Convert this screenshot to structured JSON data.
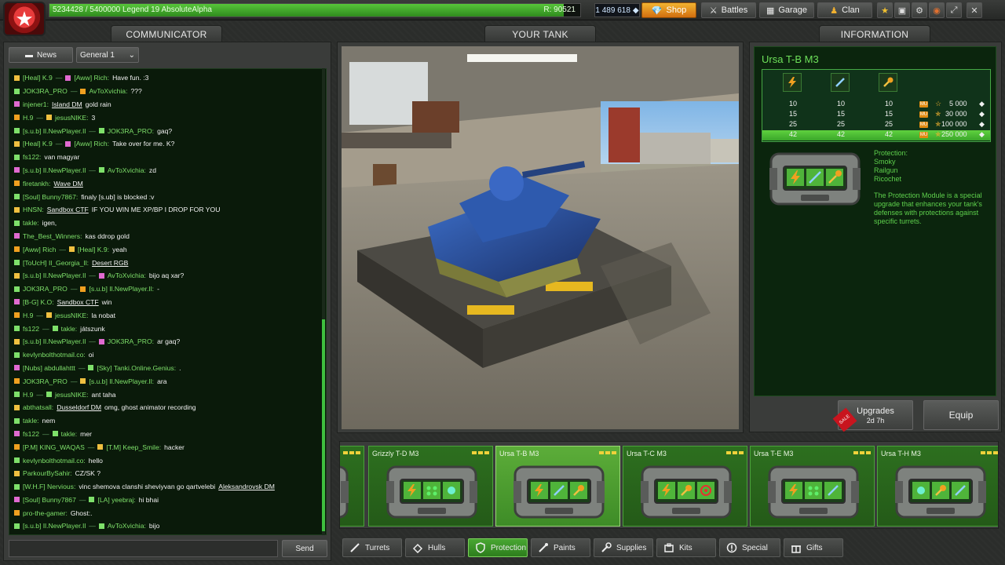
{
  "topbar": {
    "rank_text": "5234428 / 5400000   Legend 19 AbsoluteAlpha",
    "rank_progress": 0.969,
    "rating_text": "R: 90521",
    "crystals": "1 489 618",
    "buttons": [
      {
        "label": "Shop",
        "icon": "diamond-icon"
      },
      {
        "label": "Battles",
        "icon": "crossed-tools-icon"
      },
      {
        "label": "Garage",
        "icon": "garage-icon"
      },
      {
        "label": "Clan",
        "icon": "clan-icon"
      }
    ],
    "icon_buttons": [
      "star-icon",
      "tank-icon",
      "settings-icon",
      "sound-icon",
      "fullscreen-icon",
      "close-icon"
    ]
  },
  "communicator": {
    "title": "COMMUNICATOR",
    "news_label": "News",
    "channel_label": "General 1",
    "send_label": "Send",
    "input_value": "",
    "messages": [
      {
        "from": "[Heal] K.9",
        "to": "[Aww] Rich:",
        "text": "Have fun. :3"
      },
      {
        "from": "JOK3RA_PRO",
        "to": "AvToXvichia:",
        "text": "???"
      },
      {
        "from": "injener1:",
        "link": "Island DM",
        "text": "gold rain"
      },
      {
        "from": "H.9",
        "to": "jesusNIKE:",
        "text": "3"
      },
      {
        "from": "[s.u.b] Il.NewPlayer.Il",
        "to": "JOK3RA_PRO:",
        "text": "gaq?"
      },
      {
        "from": "[Heal] K.9",
        "to": "[Aww] Rich:",
        "text": "Take over for me. K?"
      },
      {
        "from": "fs122:",
        "text": "van magyar"
      },
      {
        "from": "[s.u.b] Il.NewPlayer.Il",
        "to": "AvToXvichia:",
        "text": "zd"
      },
      {
        "from": "firetankh:",
        "link": "Wave DM",
        "text": ""
      },
      {
        "from": "[Soul] Bunny7867:",
        "text": "finaly [s.ub] is blocked :v"
      },
      {
        "from": "HNSN:",
        "link": "Sandbox CTF",
        "text": "IF YOU WIN ME XP/BP I DROP FOR YOU"
      },
      {
        "from": "takle:",
        "text": "igen,"
      },
      {
        "from": "The_Best_Winners:",
        "text": "kas ddrop gold"
      },
      {
        "from": "[Aww] Rich",
        "to": "[Heal] K.9:",
        "text": "yeah"
      },
      {
        "from": "[ToUcH] Il_Georgia_Il:",
        "link": "Desert RGB",
        "text": ""
      },
      {
        "from": "[s.u.b] Il.NewPlayer.Il",
        "to": "AvToXvichia:",
        "text": "bijo aq xar?"
      },
      {
        "from": "JOK3RA_PRO",
        "to": "[s.u.b] Il.NewPlayer.Il:",
        "text": "-"
      },
      {
        "from": "[B-G] K.O:",
        "link": "Sandbox CTF",
        "text": "win"
      },
      {
        "from": "H.9",
        "to": "jesusNIKE:",
        "text": "la nobat"
      },
      {
        "from": "fs122",
        "to": "takle:",
        "text": "játszunk"
      },
      {
        "from": "[s.u.b] Il.NewPlayer.Il",
        "to": "JOK3RA_PRO:",
        "text": "ar gaq?"
      },
      {
        "from": "kevlynbolthotmail.co:",
        "text": "oi"
      },
      {
        "from": "[Nubs] abdullahttt",
        "to": "[Sky] Tanki.Online.Genius:",
        "text": "."
      },
      {
        "from": "JOK3RA_PRO",
        "to": "[s.u.b] Il.NewPlayer.Il:",
        "text": "ara"
      },
      {
        "from": "H.9",
        "to": "jesusNIKE:",
        "text": "ant taha"
      },
      {
        "from": "abthatsall:",
        "link": "Dusseldorf DM",
        "text": "omg, ghost animator recording"
      },
      {
        "from": "takle:",
        "text": "nem"
      },
      {
        "from": "fs122",
        "to": "takle:",
        "text": "mer"
      },
      {
        "from": "[P.M] KING_WAQAS",
        "to": "[T.M] Keep_Smile:",
        "text": "hacker"
      },
      {
        "from": "kevlynbolthotmail.co:",
        "text": "hello"
      },
      {
        "from": "ParkourBySahir:",
        "text": "CZ/SK ?"
      },
      {
        "from": "[W.H.F] Nervious:",
        "text": "vinc shemova clanshi sheviyvan go qartvelebi",
        "link_after": "Aleksandrovsk DM"
      },
      {
        "from": "[Soul] Bunny7867",
        "to": "[LA] yeebraj:",
        "text": "hi bhai"
      },
      {
        "from": "pro-the-gamer:",
        "text": "Ghost:."
      },
      {
        "from": "[s.u.b] Il.NewPlayer.Il",
        "to": "AvToXvichia:",
        "text": "bijo"
      }
    ]
  },
  "your_tank": {
    "title": "YOUR TANK"
  },
  "information": {
    "title": "INFORMATION",
    "item_name": "Ursa T-B M3",
    "table": [
      {
        "a": "10",
        "b": "10",
        "c": "10",
        "price": "5 000"
      },
      {
        "a": "15",
        "b": "15",
        "c": "15",
        "price": "30 000"
      },
      {
        "a": "25",
        "b": "25",
        "c": "25",
        "price": "100 000"
      },
      {
        "a": "42",
        "b": "42",
        "c": "42",
        "price": "250 000"
      }
    ],
    "protection_lines": [
      "Protection:",
      "Smoky",
      "Railgun",
      "Ricochet"
    ],
    "description": "The Protection Module is a special upgrade that enhances your tank's defenses with protections against specific turrets.",
    "upgrades_label": "Upgrades",
    "upgrades_time": "2d 7h",
    "sale_label": "SALE",
    "equip_label": "Equip"
  },
  "garage_items": [
    {
      "name": "",
      "icons": [
        "lightning-icon",
        "dots-icon"
      ],
      "selected": false
    },
    {
      "name": "Grizzly T-D M3",
      "icons": [
        "lightning-icon",
        "dots-icon",
        "freeze-icon"
      ],
      "selected": false
    },
    {
      "name": "Ursa T-B M3",
      "icons": [
        "lightning-icon",
        "rail-icon",
        "ricochet-icon"
      ],
      "selected": true
    },
    {
      "name": "Ursa T-C M3",
      "icons": [
        "lightning-icon",
        "ricochet-icon",
        "target-icon"
      ],
      "selected": false
    },
    {
      "name": "Ursa T-E M3",
      "icons": [
        "lightning-icon",
        "dots-icon",
        "rail-icon"
      ],
      "selected": false
    },
    {
      "name": "Ursa T-H M3",
      "icons": [
        "freeze-icon",
        "ricochet-icon",
        "rail-icon"
      ],
      "selected": false
    }
  ],
  "categories": [
    {
      "label": "Turrets",
      "icon": "turret-icon"
    },
    {
      "label": "Hulls",
      "icon": "hull-icon"
    },
    {
      "label": "Protection",
      "icon": "shield-icon",
      "active": true
    },
    {
      "label": "Paints",
      "icon": "brush-icon"
    },
    {
      "label": "Supplies",
      "icon": "wrench-icon"
    },
    {
      "label": "Kits",
      "icon": "kit-icon"
    },
    {
      "label": "Special",
      "icon": "special-icon"
    },
    {
      "label": "Gifts",
      "icon": "gift-icon"
    }
  ],
  "colors": {
    "accent_green": "#5ed14c",
    "shop_orange": "#e8901e",
    "chat_bg": "#0a1a0a"
  }
}
